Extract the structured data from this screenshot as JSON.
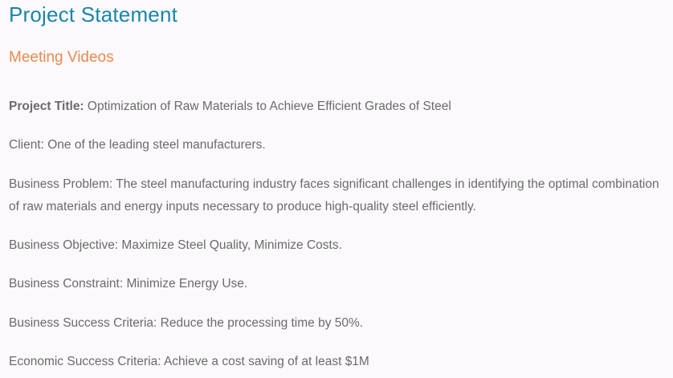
{
  "page": {
    "title": "Project Statement",
    "section_link": "Meeting Videos"
  },
  "content": {
    "project_title_label": "Project Title:",
    "project_title_value": " Optimization of Raw Materials to Achieve Efficient Grades of Steel",
    "client": "Client: One of the leading steel manufacturers.",
    "business_problem": "Business Problem: The steel manufacturing industry faces significant challenges in identifying the optimal combination of raw materials and energy inputs necessary to produce high-quality steel efficiently.",
    "business_objective": "Business Objective: Maximize Steel Quality, Minimize Costs.",
    "business_constraint": "Business Constraint: Minimize Energy Use.",
    "business_success_criteria": "Business Success Criteria: Reduce the processing time by 50%.",
    "economic_success_criteria": "Economic Success Criteria: Achieve a cost saving of at least $1M"
  },
  "colors": {
    "background": "#fbf9fb",
    "title": "#1a86a8",
    "link": "#e98a4f",
    "body_text": "#6b6b6b"
  }
}
